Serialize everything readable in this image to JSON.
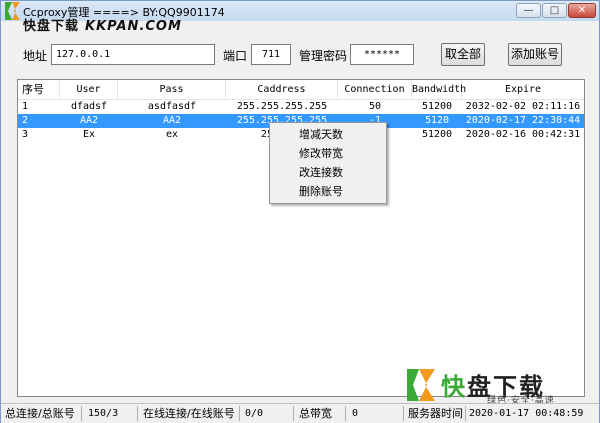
{
  "window": {
    "title": "Ccproxy管理 ====> BY:QQ9901174",
    "controls": [
      "minimize",
      "maximize",
      "close"
    ]
  },
  "watermark_top": {
    "cn": "快盘下载",
    "en": "KKPAN.COM"
  },
  "form": {
    "address_label": "地址",
    "address_value": "127.0.0.1",
    "port_label": "端口",
    "port_value": "711",
    "password_label": "管理密码",
    "password_value": "******",
    "fetch_all_button": "取全部",
    "add_account_button": "添加账号"
  },
  "table": {
    "columns": [
      "序号",
      "User",
      "Pass",
      "Caddress",
      "Connection",
      "Bandwidth",
      "Expire"
    ],
    "rows": [
      {
        "no": "1",
        "user": "dfadsf",
        "pass": "asdfasdf",
        "caddress": "255.255.255.255",
        "connection": "50",
        "bandwidth": "51200",
        "expire": "2032-02-02 02:11:16",
        "selected": false
      },
      {
        "no": "2",
        "user": "AA2",
        "pass": "AA2",
        "caddress": "255.255.255.255",
        "connection": "-1",
        "bandwidth": "5120",
        "expire": "2020-02-17 22:30:44",
        "selected": true
      },
      {
        "no": "3",
        "user": "Ex",
        "pass": "ex",
        "caddress": "255.255",
        "connection": "",
        "bandwidth": "51200",
        "expire": "2020-02-16 00:42:31",
        "selected": false
      }
    ]
  },
  "context_menu": {
    "items": [
      "增减天数",
      "修改带宽",
      "改连接数",
      "删除账号"
    ]
  },
  "statusbar": {
    "total_label": "总连接/总账号",
    "total_value": "150/3",
    "online_label": "在线连接/在线账号",
    "online_value": "0/0",
    "bandwidth_label": "总带宽",
    "bandwidth_value": "0",
    "server_time_label": "服务器时间",
    "server_time_value": "2020-01-17 00:48:59"
  },
  "watermark_bottom": {
    "cn_left": "快",
    "cn_right": "盘下载",
    "sub": "绿色·安全·高速"
  },
  "colors": {
    "selection": "#3399ff",
    "watermark_green": "#3aa935",
    "watermark_orange": "#f29a1d"
  }
}
